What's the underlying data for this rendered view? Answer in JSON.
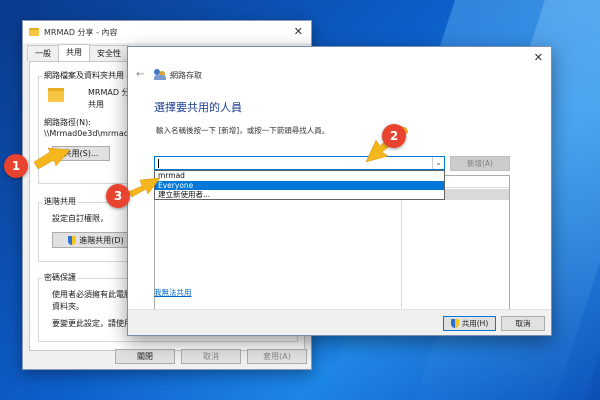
{
  "properties_window": {
    "title": "MRMAD 分享 - 內容",
    "close_symbol": "✕",
    "tabs": [
      {
        "label": "一般"
      },
      {
        "label": "共用"
      },
      {
        "label": "安全性"
      }
    ],
    "network_share_label": "網路檔案及資料夾共用",
    "share_name": "MRMAD 分",
    "share_status": "共用",
    "network_path_label": "網路路徑(N):",
    "network_path_value": "\\\\Mrmad0e3d\\mrmad",
    "share_button": "共用(S)...",
    "advanced_sharing_label": "進階共用",
    "advanced_sharing_desc": "設定自訂權限，",
    "advanced_sharing_button": "進階共用(D)",
    "password_protection_label": "密碼保護",
    "password_desc_line1": "使用者必須擁有此電腦",
    "password_desc_line2": "資料夾。",
    "password_desc_line3": "要變更此設定，請使用",
    "close_button": "關閉",
    "cancel_button": "取消",
    "apply_button": "套用(A)"
  },
  "network_access_dialog": {
    "title": "網路存取",
    "close_symbol": "✕",
    "back_symbol": "←",
    "heading": "選擇要共用的人員",
    "instruction": "輸入名稱後按一下 [新增]，或按一下箭頭尋找人員。",
    "combo_value": "",
    "add_button": "新增(A)",
    "dropdown_options": [
      {
        "label": "mrmad",
        "selected": false
      },
      {
        "label": "Everyone",
        "selected": true
      },
      {
        "label": "建立新使用者...",
        "selected": false
      }
    ],
    "cant_share_link": "我無法共用",
    "share_button": "共用(H)",
    "cancel_button": "取消"
  },
  "annotations": [
    {
      "number": "1"
    },
    {
      "number": "2"
    },
    {
      "number": "3"
    }
  ],
  "colors": {
    "accent": "#0078d7",
    "badge": "#e8432e",
    "arrow": "#f5b61d",
    "heading": "#1e3d8f"
  }
}
